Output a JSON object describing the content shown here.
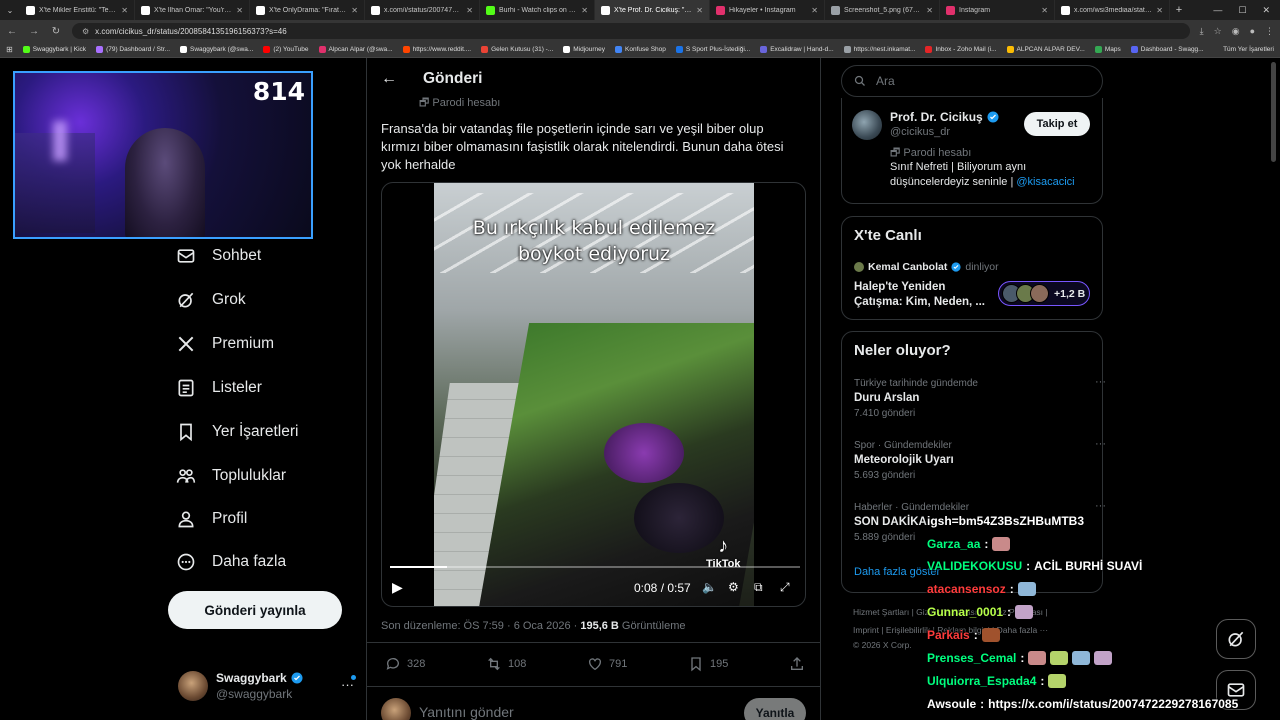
{
  "browser": {
    "tabs": [
      {
        "title": "X'te Mikler Enstitü: \"Terör örgü",
        "active": false,
        "fav": "#ffffff"
      },
      {
        "title": "X'te İlhan Omar: \"You're lying",
        "active": false,
        "fav": "#ffffff"
      },
      {
        "title": "X'te OnlyDrama: \"Fırat Sobutay",
        "active": false,
        "fav": "#ffffff"
      },
      {
        "title": "x.com/i/status/2007472229",
        "active": false,
        "fav": "#ffffff"
      },
      {
        "title": "Burhi - Watch clips on Kick",
        "active": false,
        "fav": "#53fc18"
      },
      {
        "title": "X'te Prof. Dr. Cicikuş: \"Fransa",
        "active": true,
        "fav": "#ffffff"
      },
      {
        "title": "Hikayeler • Instagram",
        "active": false,
        "fav": "#e1306c"
      },
      {
        "title": "Screenshot_5.png (672×406)",
        "active": false,
        "fav": "#9aa0a6"
      },
      {
        "title": "Instagram",
        "active": false,
        "fav": "#e1306c"
      },
      {
        "title": "x.com/wsi3mediaa/status/200",
        "active": false,
        "fav": "#ffffff"
      }
    ],
    "url": "x.com/cicikus_dr/status/2008584135196156373?s=46",
    "bookmarks": [
      {
        "label": "Swaggybark | Kick",
        "color": "#53fc18"
      },
      {
        "label": "(79) Dashboard / Str...",
        "color": "#a970ff"
      },
      {
        "label": "Swaggybark (@swa...",
        "color": "#ffffff"
      },
      {
        "label": "(2) YouTube",
        "color": "#ff0000"
      },
      {
        "label": "Alpcan Alpar (@swa...",
        "color": "#e1306c"
      },
      {
        "label": "https://www.reddit....",
        "color": "#ff4500"
      },
      {
        "label": "Gelen Kutusu (31) -...",
        "color": "#ea4335"
      },
      {
        "label": "Midjourney",
        "color": "#ffffff"
      },
      {
        "label": "Konfuse Shop",
        "color": "#4285f4"
      },
      {
        "label": "S Sport Plus-İstediği...",
        "color": "#1a73e8"
      },
      {
        "label": "Excalidraw | Hand-d...",
        "color": "#6965db"
      },
      {
        "label": "https://nest.inkamat...",
        "color": "#9aa0a6"
      },
      {
        "label": "Inbox - Zoho Mail (i...",
        "color": "#e42527"
      },
      {
        "label": "ALPCAN ALPAR DEV...",
        "color": "#fbbc04"
      },
      {
        "label": "Maps",
        "color": "#34a853"
      },
      {
        "label": "Dashboard - Swagg...",
        "color": "#5865f2"
      }
    ],
    "all_bookmarks": "Tüm Yer İşaretleri"
  },
  "cam": {
    "counter": "814"
  },
  "nav": {
    "items": [
      {
        "label": "Sohbet",
        "icon": "mail-icon"
      },
      {
        "label": "Grok",
        "icon": "grok-icon"
      },
      {
        "label": "Premium",
        "icon": "x-logo-icon"
      },
      {
        "label": "Listeler",
        "icon": "list-icon"
      },
      {
        "label": "Yer İşaretleri",
        "icon": "bookmark-icon"
      },
      {
        "label": "Topluluklar",
        "icon": "communities-icon"
      },
      {
        "label": "Profil",
        "icon": "profile-icon"
      },
      {
        "label": "Daha fazla",
        "icon": "more-icon"
      }
    ],
    "post_button": "Gönderi yayınla",
    "account": {
      "name": "Swaggybark",
      "handle": "@swaggybark"
    }
  },
  "post": {
    "header": "Gönderi",
    "parody_label": "Parodi hesabı",
    "text": "Fransa'da bir vatandaş file poşetlerin içinde sarı ve yeşil biber olup kırmızı biber olmamasını faşistlik olarak nitelendirdi. Bunun daha ötesi yok herhalde",
    "video": {
      "caption_line1": "Bu ırkçılık kabul edilemez",
      "caption_line2": "boykot ediyoruz",
      "watermark": "TikTok",
      "time": "0:08 / 0:57",
      "progress": 0.14
    },
    "edited": "Son düzenleme: ÖS 7:59 · 6 Oca 2026 · ",
    "views_count": "195,6 B",
    "views_label": " Görüntüleme",
    "stats": {
      "replies": "328",
      "reposts": "108",
      "likes": "791",
      "bookmarks": "195"
    },
    "reply_placeholder": "Yanıtını gönder",
    "reply_button": "Yanıtla"
  },
  "sidebar": {
    "search_placeholder": "Ara",
    "profile": {
      "name": "Prof. Dr. Cicikuş",
      "handle": "@cicikus_dr",
      "parody": "Parodi hesabı",
      "bio": "Sınıf Nefreti | Biliyorum aynı düşüncelerdeyiz seninle | ",
      "bio_link": "@kisacacici",
      "follow": "Takip et"
    },
    "live": {
      "title": "X'te Canlı",
      "host": "Kemal Canbolat",
      "host_status": "dinliyor",
      "space_title": "Halep'te Yeniden Çatışma: Kim, Neden, ...",
      "listeners": "+1,2 B"
    },
    "trends": {
      "title": "Neler oluyor?",
      "items": [
        {
          "context": "Türkiye tarihinde gündemde",
          "name": "Duru Arslan",
          "count": "7.410 gönderi"
        },
        {
          "context": "Spor · Gündemdekiler",
          "name": "Meteorolojik Uyarı",
          "count": "5.693 gönderi"
        },
        {
          "context": "Haberler · Gündemdekiler",
          "name": "SON DAKİKA",
          "count": "5.889 gönderi"
        }
      ],
      "show_more": "Daha fazla göster"
    },
    "footer": {
      "line1": "Hizmet Şartları  |  Gizlilik Politikası  |  Çerez Politikası  |",
      "line2": "Imprint  |  Erişilebilirlik  |  Reklam bilgisi  |  Daha fazla ···",
      "line3": "© 2026 X Corp."
    }
  },
  "chat": [
    {
      "user": "",
      "text": "igsh=bm54Z3BsZHBuMTB3",
      "color": "#ffffff",
      "emotes": 0
    },
    {
      "user": "Garza_aa",
      "text": "",
      "color": "#00ff7f",
      "emotes": 1
    },
    {
      "user": "VALIDEKOKUSU",
      "text": "ACİL BURHİ SUAVİ",
      "color": "#00ff7f",
      "emotes": 0
    },
    {
      "user": "atacansensoz",
      "text": "",
      "color": "#ff3c3c",
      "emotes": 1
    },
    {
      "user": "Gunnar_0001",
      "text": "",
      "color": "#b7ff4a",
      "emotes": 1
    },
    {
      "user": "Parkais",
      "text": "",
      "color": "#ff3c3c",
      "emotes": 1
    },
    {
      "user": "Prenses_Cemal",
      "text": "",
      "color": "#00ff7f",
      "emotes": 4
    },
    {
      "user": "Ulquiorra_Espada4",
      "text": "",
      "color": "#00ff7f",
      "emotes": 1
    },
    {
      "user": "Awsoule",
      "text": "https://x.com/i/status/2007472229278167085",
      "color": "#ffffff",
      "emotes": 0
    }
  ]
}
